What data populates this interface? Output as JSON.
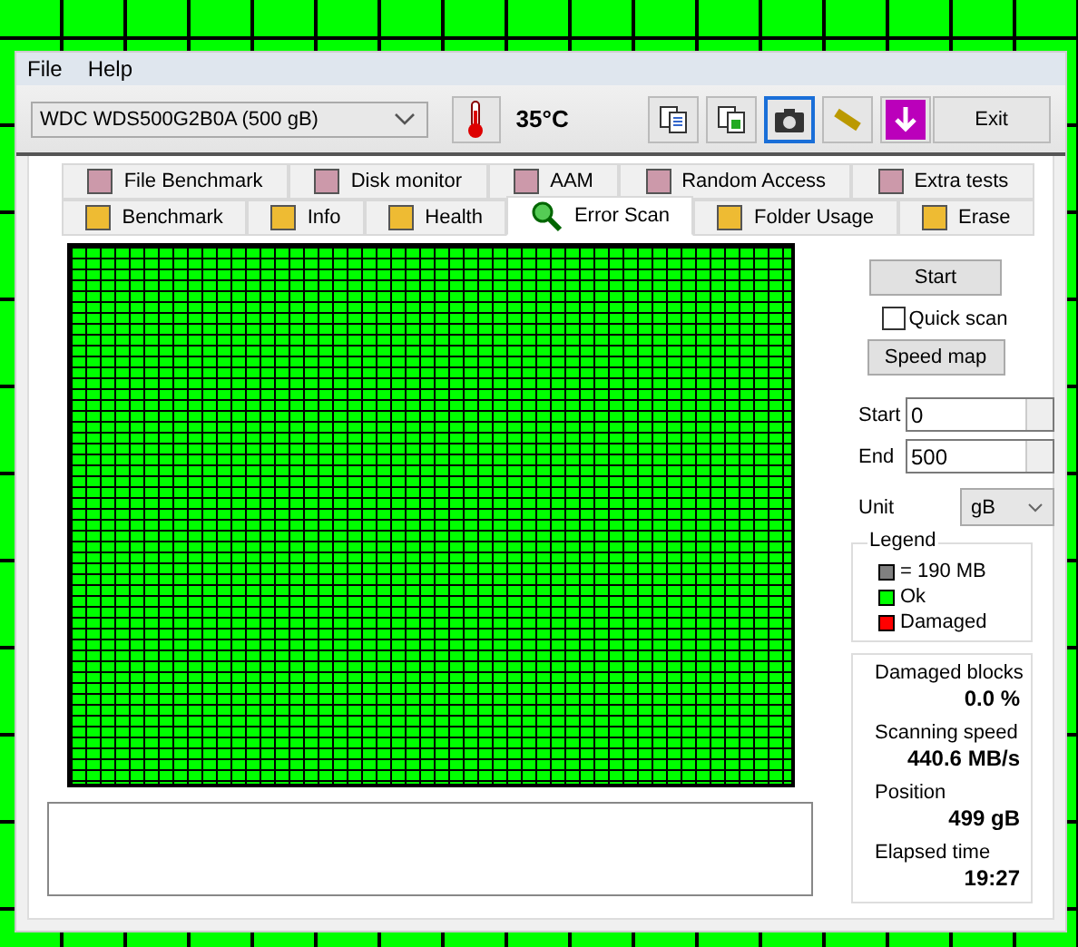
{
  "menu": [
    "File",
    "Help"
  ],
  "drive": {
    "value": "WDC WDS500G2B0A (500 gB)"
  },
  "temperature": "35°C",
  "toolbar": [
    {
      "selected": false
    },
    {
      "selected": false
    },
    {
      "selected": true
    },
    {
      "selected": false
    },
    {
      "selected": false
    }
  ],
  "exit": "Exit",
  "tabs_top": [
    {
      "label": "File Benchmark",
      "selected": false
    },
    {
      "label": "Disk monitor",
      "selected": false
    },
    {
      "label": "AAM",
      "selected": false
    },
    {
      "label": "Random Access",
      "selected": false
    },
    {
      "label": "Extra tests",
      "selected": false
    }
  ],
  "tabs_bottom": [
    {
      "label": "Benchmark",
      "selected": false
    },
    {
      "label": "Info",
      "selected": false
    },
    {
      "label": "Health",
      "selected": false
    },
    {
      "label": "Error Scan",
      "selected": true
    },
    {
      "label": "Folder Usage",
      "selected": false
    },
    {
      "label": "Erase",
      "selected": false
    }
  ],
  "scan": {
    "start_button": "Start",
    "quick_scan": {
      "label": "Quick scan",
      "checked": false
    },
    "speed_map_button": "Speed map",
    "start": {
      "label": "Start",
      "value": "0"
    },
    "end": {
      "label": "End",
      "value": "500"
    },
    "unit": {
      "label": "Unit",
      "value": "gB"
    }
  },
  "legend": {
    "title": "Legend",
    "items": [
      {
        "label": "= 190 MB",
        "color": "#808080"
      },
      {
        "label": "Ok",
        "color": "#00ff00"
      },
      {
        "label": "Damaged",
        "color": "#ff0000"
      }
    ]
  },
  "stats": [
    {
      "label": "Damaged blocks",
      "value": "0.0 %"
    },
    {
      "label": "Scanning speed",
      "value": "440.6 MB/s"
    },
    {
      "label": "Position",
      "value": "499 gB"
    },
    {
      "label": "Elapsed time",
      "value": "19:27"
    }
  ]
}
